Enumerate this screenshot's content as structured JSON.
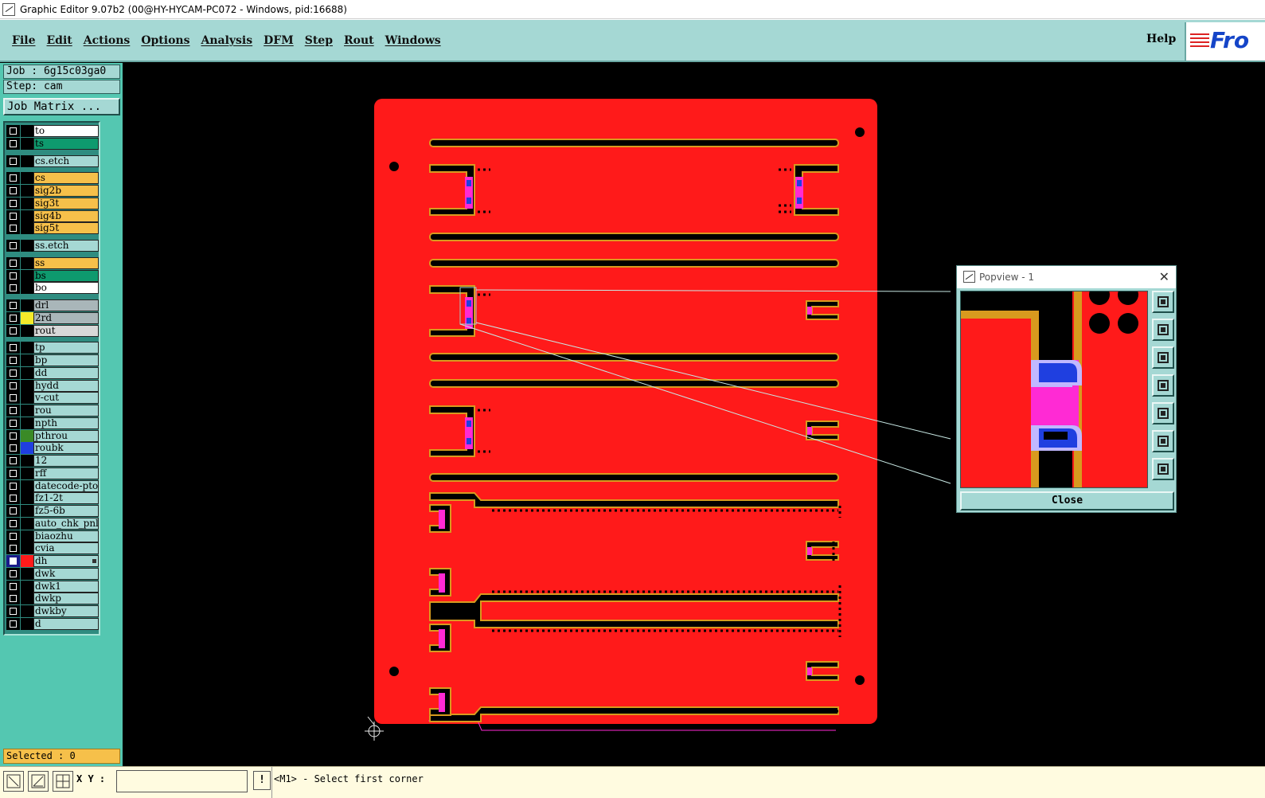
{
  "window": {
    "title": "Graphic Editor 9.07b2 (00@HY-HYCAM-PC072 - Windows, pid:16688)"
  },
  "menu": {
    "items": [
      "File",
      "Edit",
      "Actions",
      "Options",
      "Analysis",
      "DFM",
      "Step",
      "Rout",
      "Windows"
    ],
    "help": "Help",
    "logo_text": "Fro"
  },
  "job": {
    "job_line": "Job : 6g15c03ga0",
    "step_line": "Step: cam",
    "matrix_button": "Job Matrix ..."
  },
  "layers": [
    {
      "name": "to",
      "color": "#ffffff",
      "swatch": "#000000",
      "checked": false,
      "gap": false
    },
    {
      "name": "ts",
      "color": "#0e9a6e",
      "swatch": "#000000",
      "checked": false,
      "gap": false
    },
    {
      "name": "cs.etch",
      "color": "#a5d8d4",
      "swatch": "#000000",
      "checked": false,
      "gap": true
    },
    {
      "name": "cs",
      "color": "#f6c04a",
      "swatch": "#000000",
      "checked": false,
      "gap": true
    },
    {
      "name": "sig2b",
      "color": "#f6c04a",
      "swatch": "#000000",
      "checked": false,
      "gap": false
    },
    {
      "name": "sig3t",
      "color": "#f6c04a",
      "swatch": "#000000",
      "checked": false,
      "gap": false
    },
    {
      "name": "sig4b",
      "color": "#f6c04a",
      "swatch": "#000000",
      "checked": false,
      "gap": false
    },
    {
      "name": "sig5t",
      "color": "#f6c04a",
      "swatch": "#000000",
      "checked": false,
      "gap": false
    },
    {
      "name": "ss.etch",
      "color": "#a5d8d4",
      "swatch": "#000000",
      "checked": false,
      "gap": true
    },
    {
      "name": "ss",
      "color": "#f6c04a",
      "swatch": "#000000",
      "checked": false,
      "gap": true
    },
    {
      "name": "bs",
      "color": "#0e9a6e",
      "swatch": "#000000",
      "checked": false,
      "gap": false
    },
    {
      "name": "bo",
      "color": "#ffffff",
      "swatch": "#000000",
      "checked": false,
      "gap": false
    },
    {
      "name": "drl",
      "color": "#a9b6b9",
      "swatch": "#000000",
      "checked": false,
      "gap": true
    },
    {
      "name": "2rd",
      "color": "#a9b6b9",
      "swatch": "#f4ea2a",
      "checked": false,
      "gap": false
    },
    {
      "name": "rout",
      "color": "#d8d8d8",
      "swatch": "#000000",
      "checked": false,
      "gap": false
    },
    {
      "name": "tp",
      "color": "#a5d8d4",
      "swatch": "#000000",
      "checked": false,
      "gap": true
    },
    {
      "name": "bp",
      "color": "#a5d8d4",
      "swatch": "#000000",
      "checked": false,
      "gap": false
    },
    {
      "name": "dd",
      "color": "#a5d8d4",
      "swatch": "#000000",
      "checked": false,
      "gap": false
    },
    {
      "name": "hydd",
      "color": "#a5d8d4",
      "swatch": "#000000",
      "checked": false,
      "gap": false
    },
    {
      "name": "v-cut",
      "color": "#a5d8d4",
      "swatch": "#000000",
      "checked": false,
      "gap": false
    },
    {
      "name": "rou",
      "color": "#a5d8d4",
      "swatch": "#000000",
      "checked": false,
      "gap": false
    },
    {
      "name": "npth",
      "color": "#a5d8d4",
      "swatch": "#000000",
      "checked": false,
      "gap": false
    },
    {
      "name": "pthrou",
      "color": "#a5d8d4",
      "swatch": "#3a8a26",
      "checked": false,
      "gap": false
    },
    {
      "name": "roubk",
      "color": "#a5d8d4",
      "swatch": "#1f3fe0",
      "checked": false,
      "gap": false
    },
    {
      "name": "12",
      "color": "#a5d8d4",
      "swatch": "#000000",
      "checked": false,
      "gap": false
    },
    {
      "name": "rff",
      "color": "#a5d8d4",
      "swatch": "#000000",
      "checked": false,
      "gap": false
    },
    {
      "name": "datecode-pto",
      "color": "#a5d8d4",
      "swatch": "#000000",
      "checked": false,
      "gap": false
    },
    {
      "name": "fz1-2t",
      "color": "#a5d8d4",
      "swatch": "#000000",
      "checked": false,
      "gap": false
    },
    {
      "name": "fz5-6b",
      "color": "#a5d8d4",
      "swatch": "#000000",
      "checked": false,
      "gap": false
    },
    {
      "name": "auto_chk_pnl",
      "color": "#a5d8d4",
      "swatch": "#000000",
      "checked": false,
      "gap": false
    },
    {
      "name": "biaozhu",
      "color": "#a5d8d4",
      "swatch": "#000000",
      "checked": false,
      "gap": false
    },
    {
      "name": "cvia",
      "color": "#a5d8d4",
      "swatch": "#000000",
      "checked": false,
      "gap": false
    },
    {
      "name": "dh",
      "color": "#a5d8d4",
      "swatch": "#ff1a1a",
      "checked": true,
      "gap": false,
      "work": true
    },
    {
      "name": "dwk",
      "color": "#a5d8d4",
      "swatch": "#000000",
      "checked": false,
      "gap": false
    },
    {
      "name": "dwk1",
      "color": "#a5d8d4",
      "swatch": "#000000",
      "checked": false,
      "gap": false
    },
    {
      "name": "dwkp",
      "color": "#a5d8d4",
      "swatch": "#000000",
      "checked": false,
      "gap": false
    },
    {
      "name": "dwkby",
      "color": "#a5d8d4",
      "swatch": "#000000",
      "checked": false,
      "gap": false
    },
    {
      "name": "d",
      "color": "#a5d8d4",
      "swatch": "#000000",
      "checked": false,
      "gap": false
    }
  ],
  "status": {
    "selected": "Selected : 0"
  },
  "bottombar": {
    "xy_label": "X Y :",
    "xy_value": "",
    "excl": "!",
    "prompt": "<M1> - Select first corner"
  },
  "popview": {
    "title": "Popview - 1",
    "close_label": "Close"
  },
  "colors": {
    "board": "#ff1a1a",
    "copper_outline": "#d89a1e",
    "pad_magenta": "#ff2ad4",
    "blue": "#1f3fe0",
    "panel": "#a5d8d4"
  }
}
